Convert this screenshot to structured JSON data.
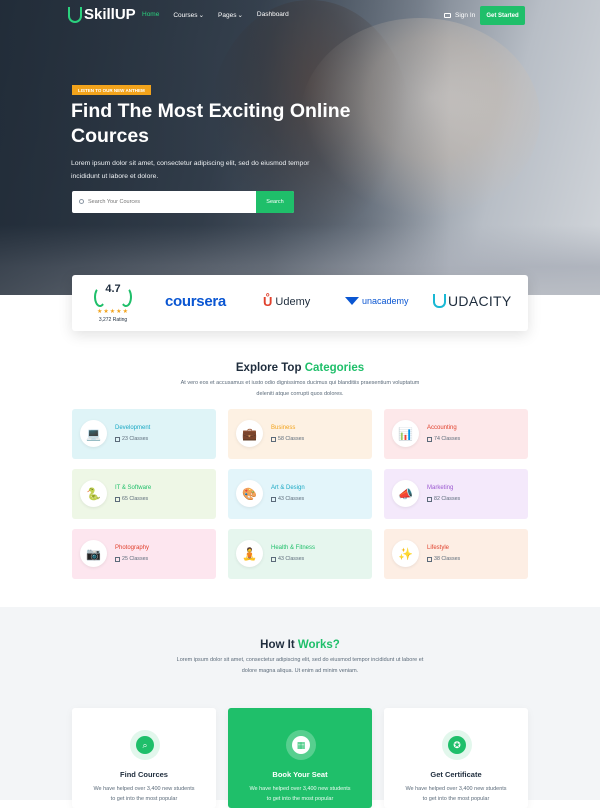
{
  "brand": {
    "name": "SkillUP"
  },
  "nav": {
    "links": [
      {
        "label": "Home",
        "active": true
      },
      {
        "label": "Courses",
        "active": false
      },
      {
        "label": "Pages",
        "active": false
      },
      {
        "label": "Dashboard",
        "active": false
      }
    ],
    "signin": "Sign In",
    "cta": "Get Started"
  },
  "hero": {
    "tag": "LISTEN TO OUR NEW ANTHEM",
    "title": "Find The Most Exciting Online Cources",
    "subtitle": "Lorem ipsum dolor sit amet, consectetur adipiscing elit, sed do eiusmod tempor incididunt ut labore et dolore.",
    "search_placeholder": "Search Your Cources",
    "search_button": "Search"
  },
  "partners": {
    "rating": {
      "score": "4.7",
      "stars": "★★★★★",
      "count": "3,272 Rating"
    },
    "logos": [
      "coursera",
      "Udemy",
      "unacademy",
      "UDACITY"
    ]
  },
  "categories": {
    "title_prefix": "Explore Top",
    "title_accent": "Categories",
    "subtitle": "At vero eos et accusamus et iusto odio dignissimos ducimus qui blanditiis praesentium voluptatum deleniti atque corrupti quos dolores.",
    "items": [
      {
        "name": "Development",
        "classes": "23 Classes",
        "icon": "laptop-icon",
        "color": "#1aa8c4",
        "bg": "#dff4f7"
      },
      {
        "name": "Business",
        "classes": "58 Classes",
        "icon": "briefcase-icon",
        "color": "#f2a31b",
        "bg": "#fdf1e3"
      },
      {
        "name": "Accounting",
        "classes": "74 Classes",
        "icon": "chart-icon",
        "color": "#e0412d",
        "bg": "#fde8ea"
      },
      {
        "name": "IT & Software",
        "classes": "65 Classes",
        "icon": "python-icon",
        "color": "#1fbf6a",
        "bg": "#eef7e6"
      },
      {
        "name": "Art & Design",
        "classes": "43 Classes",
        "icon": "palette-icon",
        "color": "#1aa8c4",
        "bg": "#e3f5fa"
      },
      {
        "name": "Marketing",
        "classes": "82 Classes",
        "icon": "megaphone-icon",
        "color": "#9b59d0",
        "bg": "#f4e9fb"
      },
      {
        "name": "Photography",
        "classes": "25 Classes",
        "icon": "camera-icon",
        "color": "#e0412d",
        "bg": "#fde6ef"
      },
      {
        "name": "Health & Fitness",
        "classes": "43 Classes",
        "icon": "fitness-icon",
        "color": "#1fbf6a",
        "bg": "#e6f6ee"
      },
      {
        "name": "Lifestyle",
        "classes": "38 Classes",
        "icon": "lifestyle-icon",
        "color": "#e0412d",
        "bg": "#fdeee4"
      }
    ]
  },
  "how": {
    "title_prefix": "How It",
    "title_accent": "Works?",
    "subtitle": "Lorem ipsum dolor sit amet, consectetur adipiscing elit, sed do eiusmod tempor incididunt ut labore et dolore magna aliqua. Ut enim ad minim veniam.",
    "steps": [
      {
        "title": "Find Cources",
        "desc": "We have helped over 3,400 new students to get into the most popular",
        "icon": "search-icon",
        "active": false
      },
      {
        "title": "Book Your Seat",
        "desc": "We have helped over 3,400 new students to get into the most popular",
        "icon": "calendar-icon",
        "active": true
      },
      {
        "title": "Get Certificate",
        "desc": "We have helped over 3,400 new students to get into the most popular",
        "icon": "certificate-icon",
        "active": false
      }
    ]
  }
}
